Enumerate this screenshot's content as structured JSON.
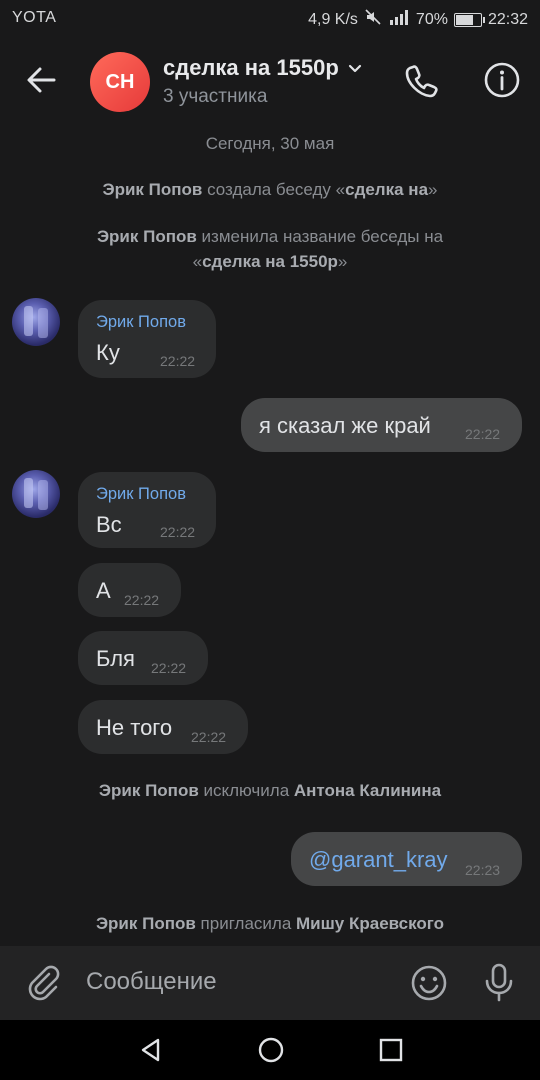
{
  "status_bar": {
    "carrier": "YOTA",
    "speed": "4,9 K/s",
    "battery": "70%",
    "battery_level": 0.7,
    "time": "22:32"
  },
  "header": {
    "avatar_initials": "СН",
    "title": "сделка на 1550р",
    "subtitle": "3 участника"
  },
  "messages": {
    "date": "Сегодня, 30 мая",
    "sys1": {
      "author": "Эрик Попов",
      "action": " создала беседу «",
      "target": "сделка на",
      "close": "»"
    },
    "sys2": {
      "author": "Эрик Попов",
      "action": " изменила название беседы на",
      "open": "«",
      "target": "сделка на 1550р",
      "close": "»"
    },
    "in1": {
      "author": "Эрик Попов",
      "text": "Ку",
      "time": "22:22"
    },
    "out1": {
      "text": "я сказал же край",
      "time": "22:22"
    },
    "in2": {
      "author": "Эрик Попов",
      "text": "Вс",
      "time": "22:22"
    },
    "in3": {
      "text": "А",
      "time": "22:22"
    },
    "in4": {
      "text": "Бля",
      "time": "22:22"
    },
    "in5": {
      "text": "Не того",
      "time": "22:22"
    },
    "sys3": {
      "author": "Эрик Попов",
      "action": " исключила ",
      "target": "Антона Калинина"
    },
    "out2": {
      "text": "@garant_kray",
      "time": "22:23"
    },
    "sys4": {
      "author": "Эрик Попов",
      "action": " пригласила ",
      "target": "Мишу Краевского"
    }
  },
  "composer": {
    "placeholder": "Сообщение"
  },
  "colors": {
    "background": "#19191a",
    "bubble_in": "#2c2d2e",
    "bubble_out": "#454647",
    "accent_blue": "#71aaeb",
    "avatar_red": "#e63a3a"
  }
}
